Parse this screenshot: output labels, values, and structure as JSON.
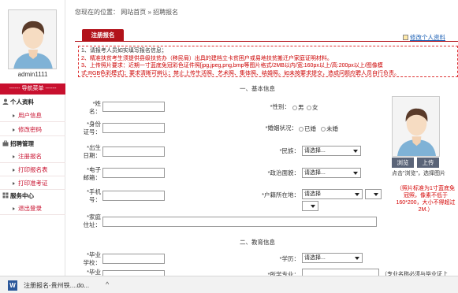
{
  "sidebar": {
    "username": "admin1111",
    "nav_header": "------ 导航菜单 ------",
    "groups": [
      {
        "label": "个人资料",
        "items": [
          "用户信息",
          "修改密码"
        ]
      },
      {
        "label": "招聘管理",
        "items": [
          "注册报名",
          "打印报名表",
          "打印准考证"
        ]
      },
      {
        "label": "服务中心",
        "items": [
          "退出登录"
        ]
      }
    ]
  },
  "breadcrumb": "您现在的位置： 网站首页 » 招聘报名",
  "tab_label": "注册报名",
  "edit_link": "修改个人资料",
  "notice": [
    "1、请报考人员如实填写报名信息；",
    "2、精准扶贫考生须提供县级扶贫办（移民局）出具的建档立卡贫困户或易地扶贫搬迁户家庭证明材料。",
    "3、上传照片要求：近期一寸蓝底免冠彩色证件照[jpg,jpeg,png,bmp等图片格式/2MB以内/宽:160px以上/高:200px以上/图像模",
    "式:RGB色彩模式]；要求清晰可辨认；禁止上传生活照、艺术照、集体照、结婚照。如未按要求提交，造成问题应聘人员自行负责。"
  ],
  "sections": {
    "basic": "一、基本信息",
    "education": "二、教育信息"
  },
  "form": {
    "name": "*姓名：",
    "id_number": "*身份证号：",
    "birth_date": "*出生日期：",
    "email": "*电子邮箱：",
    "phone": "*手机号：",
    "address": "*家庭住址：",
    "gender_label": "*性别：",
    "gender_male": "男",
    "gender_female": "女",
    "marital_label": "*婚姻状况：",
    "marital_no": "已婚",
    "marital_yes": "未婚",
    "ethnicity_label": "*民族：",
    "ethnicity_value": "请选择...",
    "politics_label": "*政治面貌：",
    "politics_value": "请选择...",
    "hukou_label": "*户籍所在地：",
    "hukou_value": "请选择",
    "school": "*毕业学校：",
    "graduation": "*毕业",
    "education_label": "*学历：",
    "education_value": "请选择...",
    "major_label": "*所学专业：",
    "major_note": "（专业名称必须与毕业证上"
  },
  "photo": {
    "browse": "浏览",
    "upload": "上传",
    "hint": "点击\"浏览\"，选择图片",
    "requirement": "（照片标准为1寸蓝底免冠照，像素不低于160*200，大小不得超过2M.）"
  },
  "taskbar": {
    "filename": "注册报名-贵州铁....do...",
    "icon": "W"
  },
  "colors": {
    "brand_red": "#b2121a",
    "nav_red": "#c8102e",
    "notice_red": "#cc0000"
  }
}
